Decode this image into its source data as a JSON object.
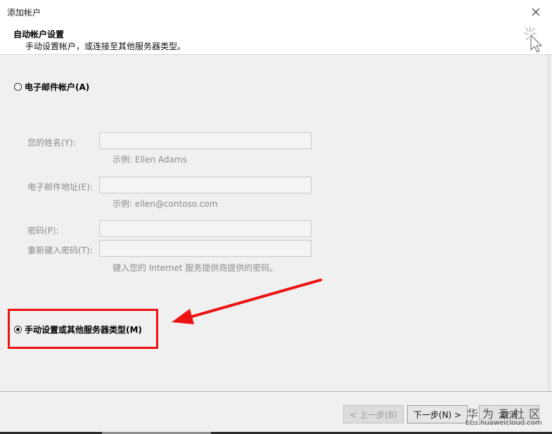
{
  "window": {
    "title": "添加帐户"
  },
  "header": {
    "title": "自动帐户设置",
    "subtitle": "手动设置帐户，或连接至其他服务器类型。"
  },
  "email_account_option": {
    "label": "电子邮件帐户(A)",
    "selected": false
  },
  "fields": {
    "name": {
      "label": "您的姓名(Y):",
      "value": "",
      "hint": "示例: Ellen Adams"
    },
    "email": {
      "label": "电子邮件地址(E):",
      "value": "",
      "hint": "示例: ellen@contoso.com"
    },
    "password": {
      "label": "密码(P):",
      "value": ""
    },
    "retype_password": {
      "label": "重新键入密码(T):",
      "value": "",
      "hint": "键入您的 Internet 服务提供商提供的密码。"
    }
  },
  "manual_option": {
    "label": "手动设置或其他服务器类型(M)",
    "selected": true
  },
  "buttons": {
    "back": "< 上一步(B)",
    "next": "下一步(N) >",
    "cancel": "取消"
  },
  "watermark": {
    "brand": "华为云社区",
    "url": "bbs.huaweicloud.com"
  },
  "colors": {
    "annotation": "#e11111",
    "window_bg": "#f0f0f0"
  },
  "icons": {
    "close": "close-icon",
    "wizard": "wizard-sparkle-cursor-icon",
    "arrow": "red-arrow-annotation"
  }
}
